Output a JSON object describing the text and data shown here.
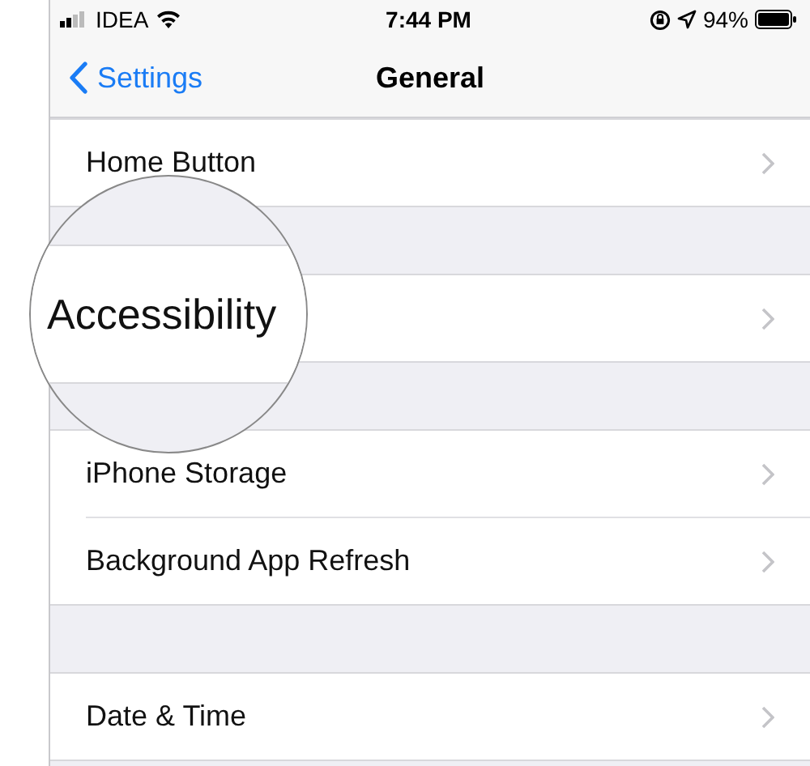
{
  "status_bar": {
    "carrier": "IDEA",
    "time": "7:44 PM",
    "battery": "94%"
  },
  "nav": {
    "back": "Settings",
    "title": "General"
  },
  "groups": [
    {
      "rows": [
        {
          "label": "Home Button"
        }
      ]
    },
    {
      "rows": [
        {
          "label": ""
        }
      ]
    },
    {
      "rows": [
        {
          "label": "iPhone Storage"
        },
        {
          "label": "Background App Refresh"
        }
      ]
    },
    {
      "rows": [
        {
          "label": "Date & Time"
        }
      ]
    }
  ],
  "magnifier": {
    "label": "Accessibility"
  }
}
